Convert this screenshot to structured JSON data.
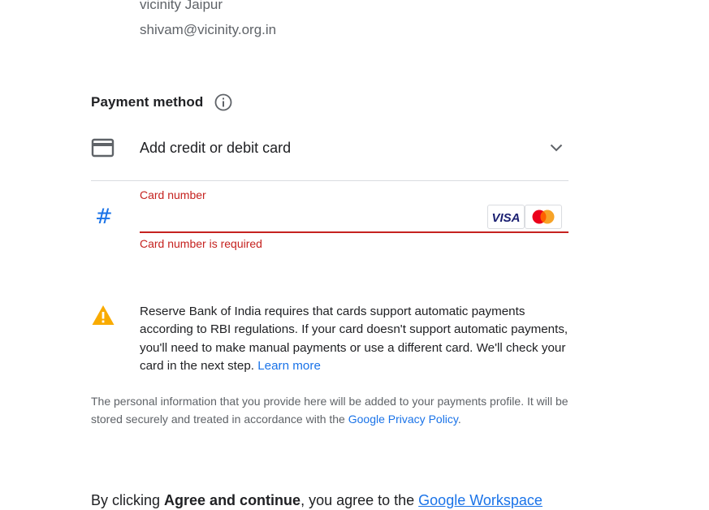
{
  "contact": {
    "org_line": "vicinity Jaipur",
    "email": "shivam@vicinity.org.in"
  },
  "payment": {
    "section_title": "Payment method",
    "info_icon": "info-icon",
    "card_option_label": "Add credit or debit card",
    "card_icon": "credit-card-icon",
    "expand_icon": "chevron-down-icon"
  },
  "card_field": {
    "label": "Card number",
    "value": "",
    "error": "Card number is required",
    "hash_glyph": "#",
    "error_color": "#c5221f",
    "brands": [
      {
        "name": "VISA",
        "icon": "visa-logo"
      },
      {
        "name": "Mastercard",
        "icon": "mastercard-logo"
      }
    ]
  },
  "notice": {
    "icon": "warning-icon",
    "text": "Reserve Bank of India requires that cards support automatic payments according to RBI regulations. If your card doesn't support automatic payments, you'll need to make manual payments or use a different card. We'll check your card in the next step. ",
    "link_label": "Learn more"
  },
  "privacy": {
    "text": "The personal information that you provide here will be added to your payments profile. It will be stored securely and treated in accordance with the ",
    "link_label": "Google Privacy Policy",
    "suffix": "."
  },
  "agreement": {
    "prefix": "By clicking ",
    "bold": "Agree and continue",
    "middle": ", you agree to the ",
    "link_label": "Google Workspace"
  },
  "colors": {
    "accent": "#1a73e8",
    "error": "#c5221f",
    "warning": "#f9ab00",
    "visa_blue": "#1a1f71",
    "mc_red": "#eb001b",
    "mc_orange": "#f79e1b"
  }
}
